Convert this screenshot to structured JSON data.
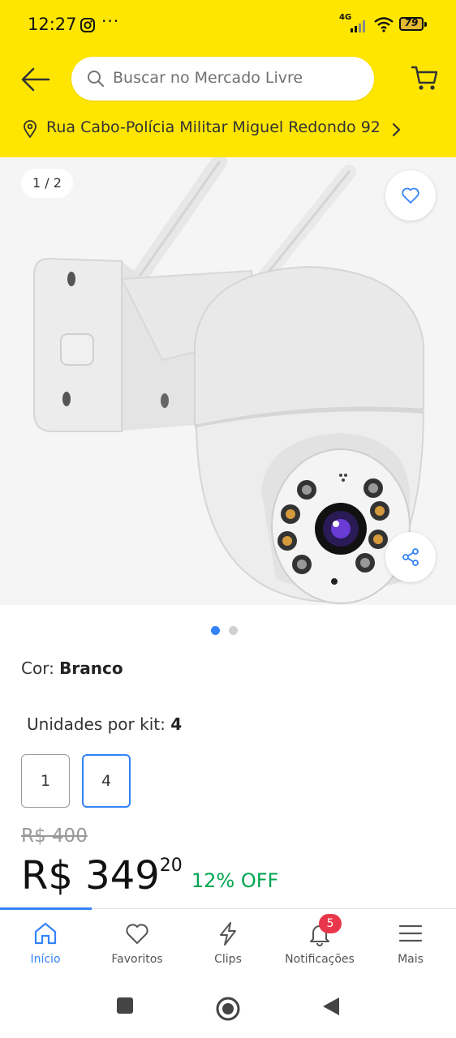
{
  "status_bar": {
    "time": "12:27",
    "dots": "···",
    "network": "4G",
    "battery": "79"
  },
  "header": {
    "search_placeholder": "Buscar no Mercado Livre",
    "address": "Rua Cabo-Polícia Militar Miguel Redondo 92",
    "background_color": "#fee600"
  },
  "gallery": {
    "counter": "1 / 2",
    "current_page": 1,
    "total_pages": 2
  },
  "variations": {
    "color_label": "Cor:",
    "color_value": "Branco",
    "units_label": "Unidades por kit:",
    "units_value": "4",
    "unit_options": [
      "1",
      "4"
    ],
    "selected_option": "4"
  },
  "price": {
    "old": "R$ 400",
    "current_main": "R$ 349",
    "current_cents": "20",
    "discount": "12% OFF",
    "discount_color": "#00a650"
  },
  "bottom_nav": {
    "items": [
      {
        "label": "Início",
        "icon": "home-icon",
        "active": true
      },
      {
        "label": "Favoritos",
        "icon": "heart-icon",
        "active": false
      },
      {
        "label": "Clips",
        "icon": "lightning-icon",
        "active": false
      },
      {
        "label": "Notificações",
        "icon": "bell-icon",
        "active": false,
        "badge": "5"
      },
      {
        "label": "Mais",
        "icon": "menu-icon",
        "active": false
      }
    ],
    "accent_color": "#3483fa"
  }
}
